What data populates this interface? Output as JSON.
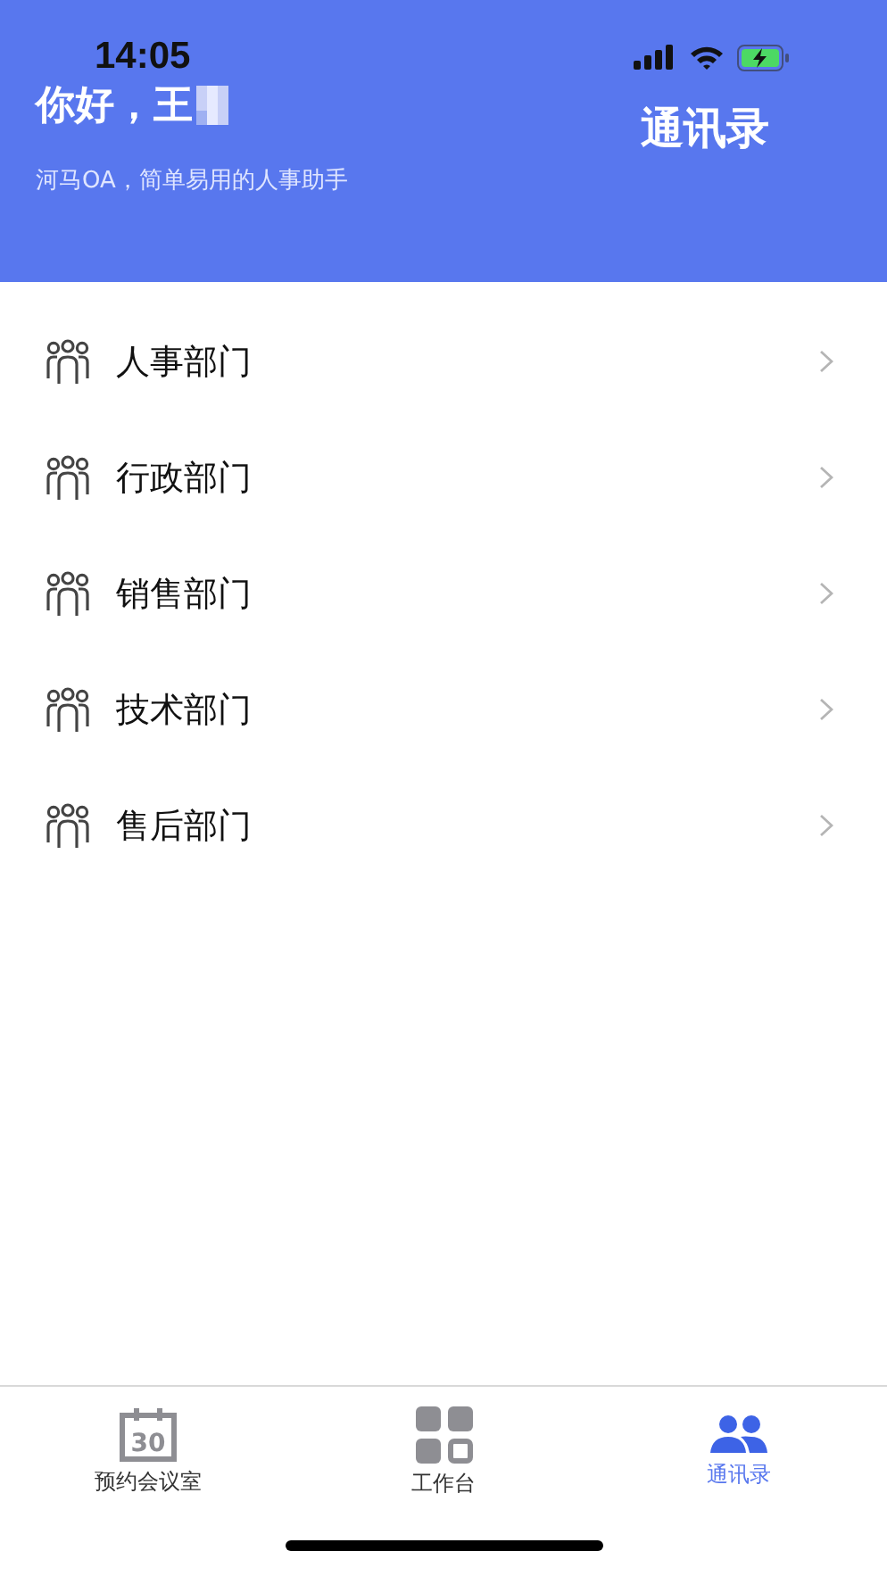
{
  "status_bar": {
    "time": "14:05"
  },
  "header": {
    "greeting": "你好，王",
    "subtitle": "河马OA，简单易用的人事助手",
    "title": "通讯录"
  },
  "departments": [
    {
      "label": "人事部门"
    },
    {
      "label": "行政部门"
    },
    {
      "label": "销售部门"
    },
    {
      "label": "技术部门"
    },
    {
      "label": "售后部门"
    }
  ],
  "tab_bar": [
    {
      "kind": "calendar",
      "icon_text": "30",
      "label": "预约会议室",
      "selected": false
    },
    {
      "kind": "grid",
      "label": "工作台",
      "selected": false
    },
    {
      "kind": "people",
      "label": "通讯录",
      "selected": true
    }
  ]
}
